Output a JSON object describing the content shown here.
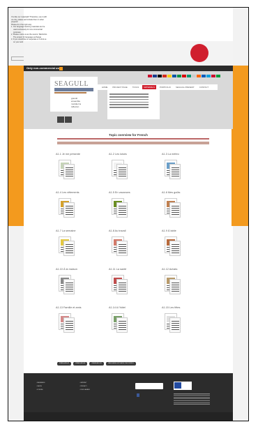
{
  "notice": {
    "lines": [
      "You like our materials? Therefore, use it with",
      "us only, please and include them in other",
      "projects!",
      "Please do it the right way:",
      "1. Our language learning materials can be",
      "   used exclusively for non-commercial",
      "   purposes.",
      "2. Please notice us as the source: SEAGULL",
      "   The project for language exchange",
      "3. If you would like to cooperate or to link us",
      "   on your web pages, please use our logo."
    ],
    "email": "send/mail us on: seagull@seagull-tandem.eu"
  },
  "bar": {
    "label": "Only non-commercial use!"
  },
  "logo": {
    "name": "SEAGULL"
  },
  "hero": {
    "text_lines": [
      "grandir",
      "ensemble",
      "moduler la",
      "réflexion"
    ]
  },
  "menu": {
    "items": [
      "HOME",
      "PROJECT PAGE",
      "TOOLS",
      "MATERIALS",
      "PORTFOLIO",
      "SEAGULL PRESENT",
      "CONTACT"
    ],
    "active_index": 3
  },
  "flags": [
    "#c8102e",
    "#1a3c8c",
    "#000000",
    "#d52b1e",
    "#ffce00",
    "#0055a4",
    "#009246",
    "#d50000",
    "#00966e",
    "#cccccc",
    "#ff6600",
    "#005bbb",
    "#00a1de",
    "#c8102e",
    "#009b3a"
  ],
  "content": {
    "title": "Topic overview for French"
  },
  "topics": [
    {
      "label": "A1.1 Je me présente",
      "color": "#c6d4b8"
    },
    {
      "label": "A1.2 Les loisirs",
      "color": "#f1f1f1"
    },
    {
      "label": "A1.3 La météo",
      "color": "#6a9fc9"
    },
    {
      "label": "A1.4 Les vêtements",
      "color": "#d4a12c"
    },
    {
      "label": "A1.5 En vacances",
      "color": "#6b8e23"
    },
    {
      "label": "A1.6 Mes goûts",
      "color": "#c08050"
    },
    {
      "label": "A1.7 La semaine",
      "color": "#e3c842"
    },
    {
      "label": "A1.8 Au travail",
      "color": "#d37a6a"
    },
    {
      "label": "A1.9 À table",
      "color": "#b86a3c"
    },
    {
      "label": "A1.10 À la maison",
      "color": "#8a8a8a"
    },
    {
      "label": "A1.11 La santé",
      "color": "#c14d4d"
    },
    {
      "label": "A1.12 Achats",
      "color": "#b89a6a"
    },
    {
      "label": "A1.13 Famille et amis",
      "color": "#d48a8a"
    },
    {
      "label": "A1.14 A l'hôtel",
      "color": "#7aa06a"
    },
    {
      "label": "A1.15 Les fêtes",
      "color": "#e0e0e0"
    }
  ],
  "footer_links": [
    "FRANÇAIS A1",
    "FRANÇAIS A2",
    "FRANÇAIS B1",
    "LANGUAGE EXPLAINS THE WORLD"
  ],
  "footer": {
    "col1": [
      "MEMBERS",
      "NEWS",
      "FORUM"
    ],
    "col2": [
      "IMPRINT",
      "PRIVACY",
      "DISCLAIMER"
    ]
  }
}
